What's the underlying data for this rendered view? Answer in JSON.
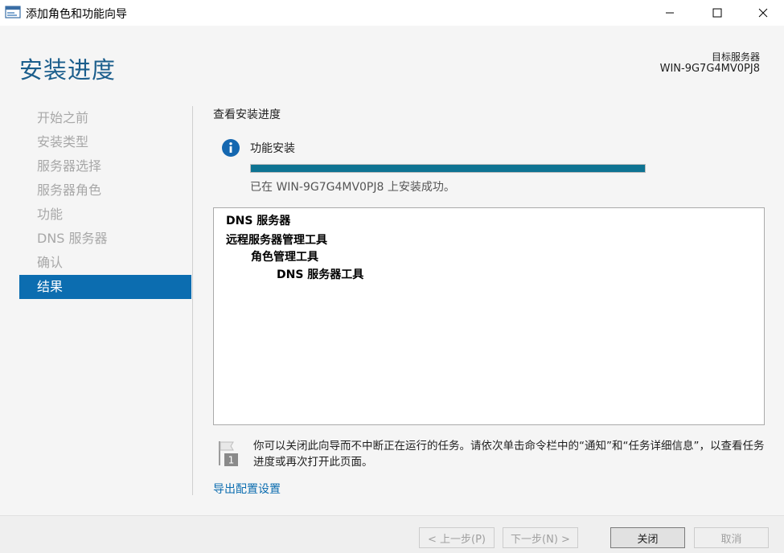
{
  "window": {
    "title": "添加角色和功能向导"
  },
  "header": {
    "page_title": "安装进度",
    "target_server_label": "目标服务器",
    "target_server_name": "WIN-9G7G4MV0PJ8"
  },
  "nav": {
    "items": [
      {
        "label": "开始之前",
        "active": false
      },
      {
        "label": "安装类型",
        "active": false
      },
      {
        "label": "服务器选择",
        "active": false
      },
      {
        "label": "服务器角色",
        "active": false
      },
      {
        "label": "功能",
        "active": false
      },
      {
        "label": "DNS 服务器",
        "active": false
      },
      {
        "label": "确认",
        "active": false
      },
      {
        "label": "结果",
        "active": true
      }
    ]
  },
  "main": {
    "section_title": "查看安装进度",
    "feature_label": "功能安装",
    "progress_percent": 100,
    "status_text": "已在 WIN-9G7G4MV0PJ8 上安装成功。",
    "results": [
      {
        "text": "DNS 服务器",
        "level": 0
      },
      {
        "text": "远程服务器管理工具",
        "level": 0
      },
      {
        "text": "角色管理工具",
        "level": 1
      },
      {
        "text": "DNS 服务器工具",
        "level": 2
      }
    ],
    "note_badge": "1",
    "note_text": "你可以关闭此向导而不中断正在运行的任务。请依次单击命令栏中的“通知”和“任务详细信息”，以查看任务进度或再次打开此页面。",
    "export_link": "导出配置设置"
  },
  "footer": {
    "prev_label": "< 上一步(P)",
    "next_label": "下一步(N) >",
    "close_label": "关闭",
    "cancel_label": "取消"
  },
  "colors": {
    "accent": "#0c6db0",
    "title_blue": "#1b5e8c",
    "progress": "#0e7392"
  }
}
